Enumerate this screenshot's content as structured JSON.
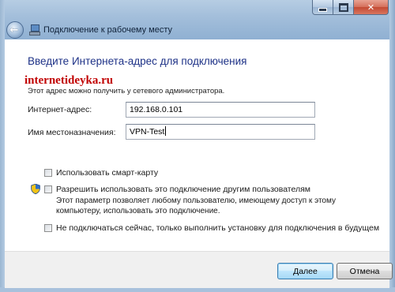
{
  "window": {
    "title": "Подключение к рабочему месту",
    "caption_buttons": {
      "minimize_icon": "minimize-icon",
      "maximize_icon": "maximize-icon",
      "close_icon": "close-icon"
    }
  },
  "main": {
    "heading": "Введите Интернета-адрес для подключения",
    "watermark": "internetideyka.ru",
    "subtext": "Этот адрес можно получить у сетевого администратора.",
    "address_label": "Интернет-адрес:",
    "address_value": "192.168.0.101",
    "destination_label": "Имя местоназначения:",
    "destination_value": "VPN-Test",
    "options": {
      "smart_card": "Использовать смарт-карту",
      "allow_others": "Разрешить использовать это подключение другим пользователям",
      "allow_others_desc_line1": "Этот параметр позволяет любому пользователю, имеющему доступ к этому",
      "allow_others_desc_line2": "компьютеру, использовать это подключение.",
      "dont_connect": "Не подключаться сейчас, только выполнить установку для подключения в будущем"
    }
  },
  "footer": {
    "next_label": "Далее",
    "cancel_label": "Отмена"
  },
  "colors": {
    "heading": "#1e3287",
    "watermark": "#c10000",
    "frame": "#a4bfdb"
  }
}
